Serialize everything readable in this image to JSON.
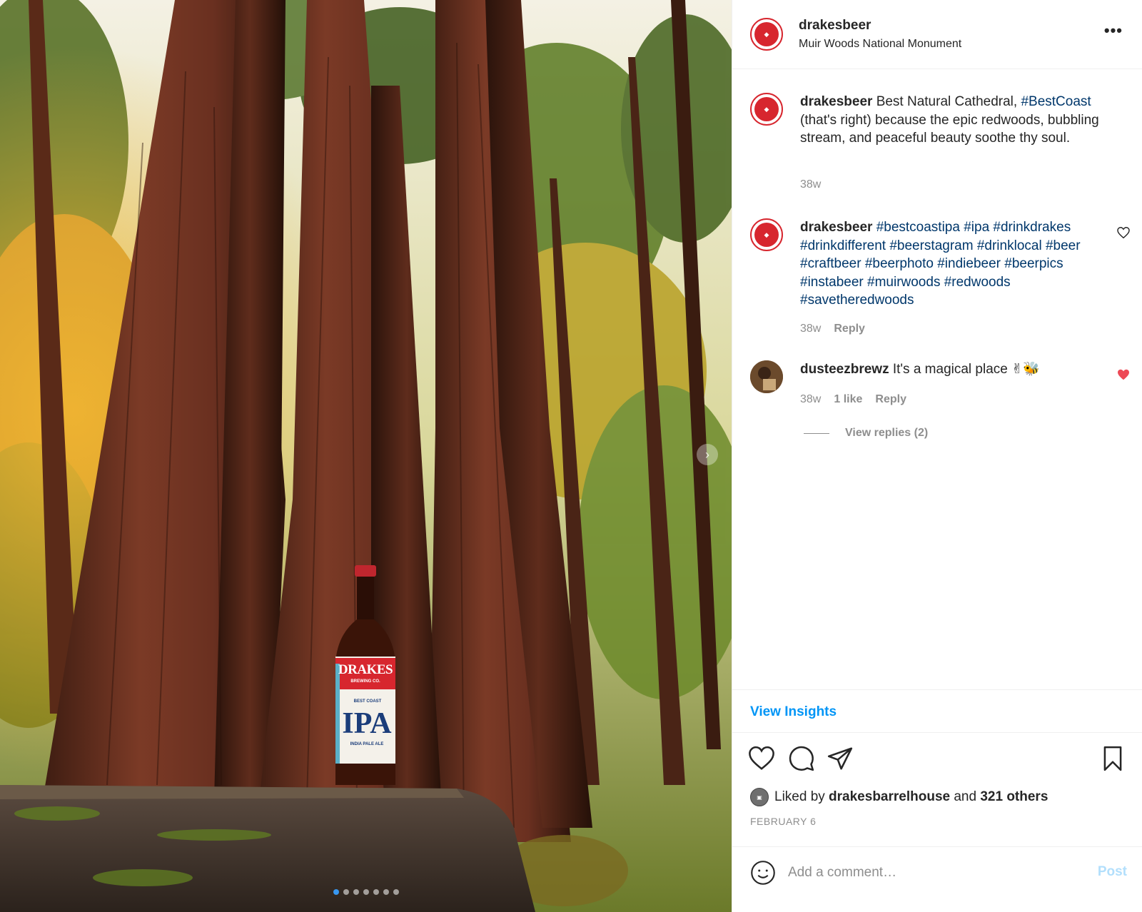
{
  "post": {
    "username": "drakesbeer",
    "location": "Muir Woods National Monument",
    "image_alt": "Drakes Best Coast IPA bottle on a rock among redwoods",
    "carousel": {
      "count": 7,
      "active_index": 0
    }
  },
  "bottle": {
    "brand": "DRAKES",
    "sub": "BREWING CO.",
    "tagline": "BEST COAST",
    "style": "IPA",
    "style_full": "INDIA PALE ALE"
  },
  "caption": {
    "username": "drakesbeer",
    "text_before": "Best Natural Cathedral, ",
    "hashtag": "#BestCoast",
    "text_after": " (that's right) because the epic redwoods, bubbling stream, and peaceful beauty soothe thy soul.",
    "time": "38w"
  },
  "comments": [
    {
      "username": "drakesbeer",
      "text": "#bestcoastipa #ipa #drinkdrakes #drinkdifferent #beerstagram #drinklocal #beer #craftbeer #beerphoto #indiebeer #beerpics #instabeer #muirwoods #redwoods #savetheredwoods",
      "time": "38w",
      "reply_label": "Reply",
      "liked": false
    },
    {
      "username": "dusteezbrewz",
      "text": "It's a magical place ✌🐝",
      "time": "38w",
      "likes_label": "1 like",
      "reply_label": "Reply",
      "liked": true,
      "view_replies": "View replies (2)"
    }
  ],
  "insights_label": "View Insights",
  "icons": [
    "heart-icon",
    "comment-icon",
    "share-icon",
    "bookmark-icon",
    "emoji-icon",
    "more-icon"
  ],
  "likes": {
    "prefix": "Liked by ",
    "user": "drakesbarrelhouse",
    "middle": " and ",
    "others": "321 others"
  },
  "date": "FEBRUARY 6",
  "comment_box": {
    "placeholder": "Add a comment…",
    "post_label": "Post"
  },
  "colors": {
    "accent": "#0095f6",
    "hashtag": "#00376b",
    "muted": "#8e8e8e",
    "like_red": "#ed4956",
    "brand_red": "#d7262e"
  }
}
